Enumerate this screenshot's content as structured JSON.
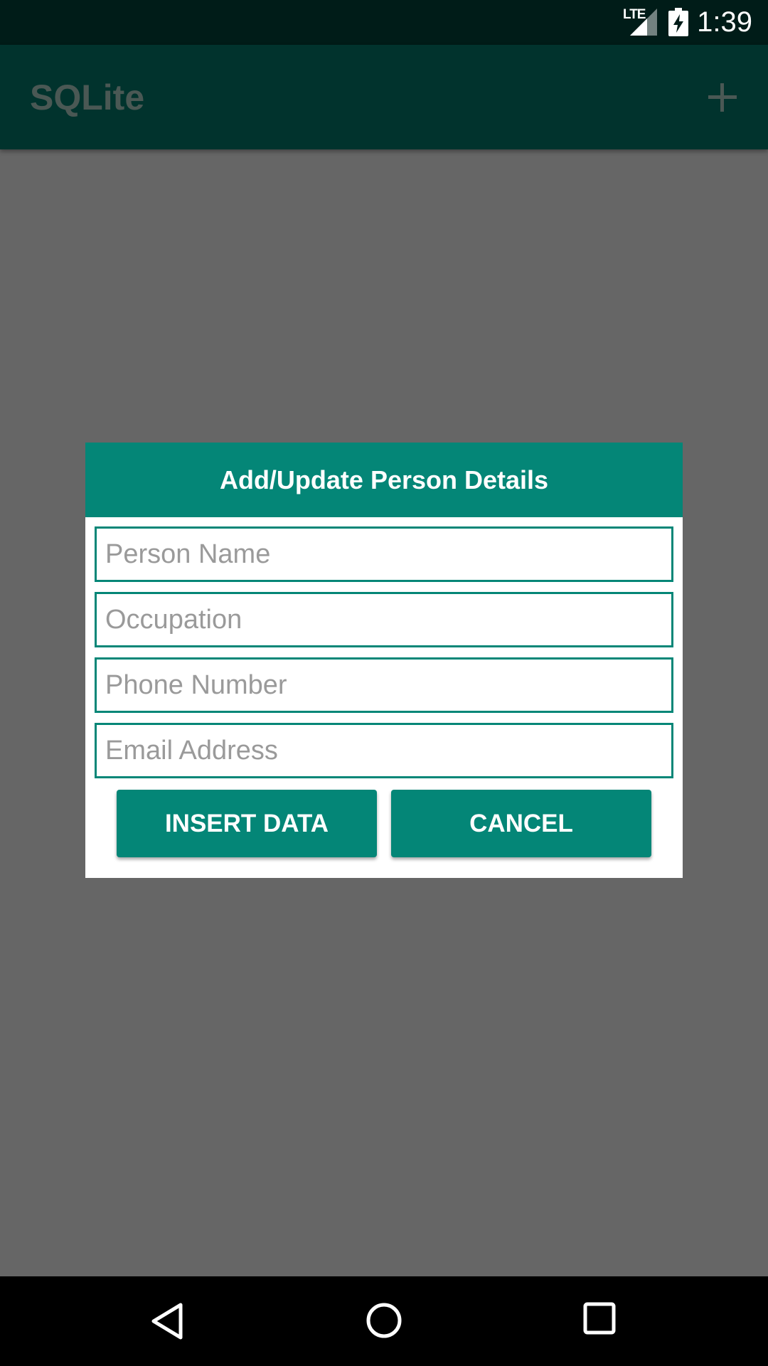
{
  "status_bar": {
    "network_label": "LTE",
    "time": "1:39",
    "icons": [
      "signal-icon",
      "battery-charging-icon"
    ]
  },
  "app_bar": {
    "title": "SQLite",
    "action_icon": "add-icon"
  },
  "dialog": {
    "title": "Add/Update Person Details",
    "fields": [
      {
        "placeholder": "Person Name",
        "value": ""
      },
      {
        "placeholder": "Occupation",
        "value": ""
      },
      {
        "placeholder": "Phone Number",
        "value": ""
      },
      {
        "placeholder": "Email Address",
        "value": ""
      }
    ],
    "buttons": {
      "insert_label": "INSERT DATA",
      "cancel_label": "CANCEL"
    }
  },
  "nav_bar": {
    "icons": [
      "back-icon",
      "home-icon",
      "recents-icon"
    ]
  },
  "colors": {
    "accent": "#048677",
    "app_bar": "#01332d",
    "status_bar": "#001c18",
    "scrim": "#666666"
  }
}
